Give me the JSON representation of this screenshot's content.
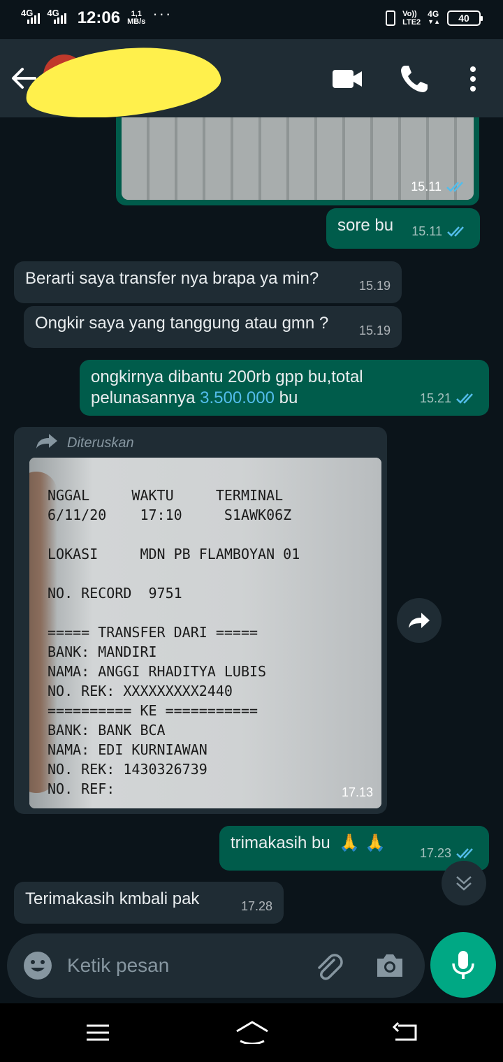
{
  "status_bar": {
    "sim1": "4G",
    "sim2": "4G",
    "time": "12:06",
    "speed_value": "1,1",
    "speed_unit": "MB/s",
    "more": "···",
    "volte_top": "Vo))",
    "volte_bottom": "LTE2",
    "network": "4G",
    "battery": "40"
  },
  "header": {
    "back_icon": "arrow-left-icon",
    "video_icon": "video-call-icon",
    "call_icon": "phone-icon",
    "menu_icon": "more-vertical-icon"
  },
  "messages": [
    {
      "type": "image-out",
      "time": "15.11"
    },
    {
      "type": "text-out",
      "text": "sore bu",
      "time": "15.11"
    },
    {
      "type": "text-in",
      "text": "Berarti saya transfer nya brapa ya min?",
      "time": "15.19"
    },
    {
      "type": "text-in",
      "text": "Ongkir saya yang tanggung atau gmn ?",
      "time": "15.19"
    },
    {
      "type": "text-out",
      "text_line1": "ongkirnya dibantu 200rb gpp bu,total",
      "text_line2_pre": "pelunasannya ",
      "text_line2_link": "3.500.000",
      "text_line2_post": " bu",
      "time": "15.21"
    },
    {
      "type": "image-in-forwarded",
      "forward_label": "Diteruskan",
      "time": "17.13",
      "receipt_lines": [
        "NGGAL     WAKTU     TERMINAL",
        "6/11/20    17:10     S1AWK06Z",
        "",
        "LOKASI     MDN PB FLAMBOYAN 01",
        "",
        "NO. RECORD  9751",
        "",
        "===== TRANSFER DARI =====",
        "BANK: MANDIRI",
        "NAMA: ANGGI RHADITYA LUBIS",
        "NO. REK: XXXXXXXXX2440",
        "========== KE ===========",
        "BANK: BANK BCA",
        "NAMA: EDI KURNIAWAN",
        "NO. REK: 1430326739",
        "NO. REF:"
      ]
    },
    {
      "type": "text-out",
      "text": "trimakasih bu",
      "emoji": "🙏 🙏",
      "time": "17.23"
    },
    {
      "type": "text-in",
      "text": "Terimakasih kmbali pak",
      "time": "17.28"
    }
  ],
  "input": {
    "placeholder": "Ketik pesan",
    "emoji_icon": "emoji-icon",
    "attach_icon": "paperclip-icon",
    "camera_icon": "camera-icon",
    "mic_icon": "microphone-icon"
  },
  "colors": {
    "chat_bg": "#0b141a",
    "incoming": "#1f2c34",
    "outgoing": "#005c4b",
    "accent": "#00a884",
    "read_tick": "#53bdeb"
  }
}
